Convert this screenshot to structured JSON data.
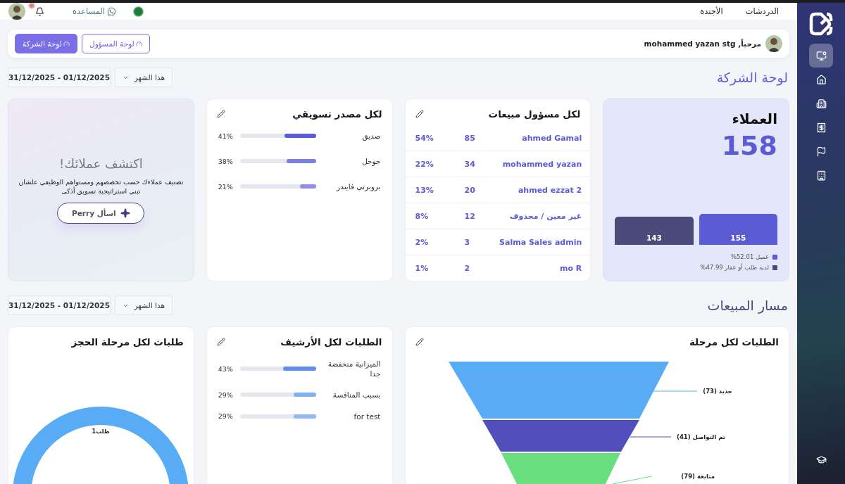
{
  "sidebar": {
    "items": [
      {
        "selected": true
      },
      {
        "selected": false
      },
      {
        "selected": false
      },
      {
        "selected": false
      },
      {
        "selected": false
      },
      {
        "selected": false
      }
    ],
    "bottom_items": [
      {
        "selected": false
      }
    ]
  },
  "topbar": {
    "nav": [
      "الدردشات",
      "الأجندة"
    ],
    "help": "المساعدة",
    "has_notification": true
  },
  "welcome": {
    "greeting": "مرحباً, mohammed yazan stg",
    "tabs": [
      {
        "label": "لوحة المسؤول",
        "selected": false
      },
      {
        "label": "لوحة الشركة",
        "selected": true
      }
    ]
  },
  "company_section": {
    "title": "لوحة الشركة",
    "period": "هذا الشهر",
    "date_range": "31/12/2025 - 01/12/2025",
    "customers": {
      "title": "العملاء",
      "total": "158",
      "bars": [
        {
          "value": "155"
        },
        {
          "value": "143"
        }
      ],
      "legend": [
        {
          "label": "عميل 52.01%",
          "color": "#5b5bd6"
        },
        {
          "label": "لديه طلب أو عقار 47.99%",
          "color": "#4b4a7a"
        }
      ]
    },
    "sales_reps": {
      "title": "لكل مسؤول مبيعات",
      "rows": [
        {
          "name": "ahmed Gamal",
          "count": "85",
          "share": "54%"
        },
        {
          "name": "mohammed yazan",
          "count": "34",
          "share": "22%"
        },
        {
          "name": "ahmed ezzat 2",
          "count": "20",
          "share": "13%"
        },
        {
          "name": "غير معين / محذوف",
          "count": "12",
          "share": "8%"
        },
        {
          "name": "Salma Sales admin",
          "count": "3",
          "share": "2%"
        },
        {
          "name": "mo R",
          "count": "2",
          "share": "1%"
        }
      ]
    },
    "marketing_sources": {
      "title": "لكل مصدر تسويقي",
      "rows": [
        {
          "label": "صديق",
          "level": 0.41,
          "reading": "41%"
        },
        {
          "label": "جوجل",
          "level": 0.38,
          "reading": "38%"
        },
        {
          "label": "بروبرتي فايندر",
          "level": 0.21,
          "reading": "21%"
        }
      ]
    },
    "discover": {
      "title": "اكتشف عملائك!",
      "text": "تصنيف عملاءك حسب تخصصهم ومستواهم الوظيفي علشان تبني استراتيجية تسويق أذكى",
      "button": "اسأل Perry"
    }
  },
  "pipeline_section": {
    "title": "مسار المبيعات",
    "period": "هذا الشهر",
    "date_range": "31/12/2025 - 01/12/2025",
    "stages_card": {
      "title": "الطلبات لكل مرحلة",
      "stages": [
        {
          "label": "جديد (73)",
          "color": "#58acf5"
        },
        {
          "label": "تم التواصل (41)",
          "color": "#524fbd"
        },
        {
          "label": "متابعة (79)",
          "color": "#68de7e"
        }
      ]
    },
    "archive_card": {
      "title": "الطلبات لكل الأرشيف",
      "rows": [
        {
          "label": "الميزانية منخفضة جدا",
          "level": 0.43,
          "reading": "43%"
        },
        {
          "label": "بسبب المنافسة",
          "level": 0.29,
          "reading": "29%"
        },
        {
          "label": "for test",
          "level": 0.29,
          "reading": "29%"
        }
      ]
    },
    "booking_card": {
      "title": "طلبات لكل مرحلة الحجز",
      "donut_label": "1طلب"
    }
  }
}
